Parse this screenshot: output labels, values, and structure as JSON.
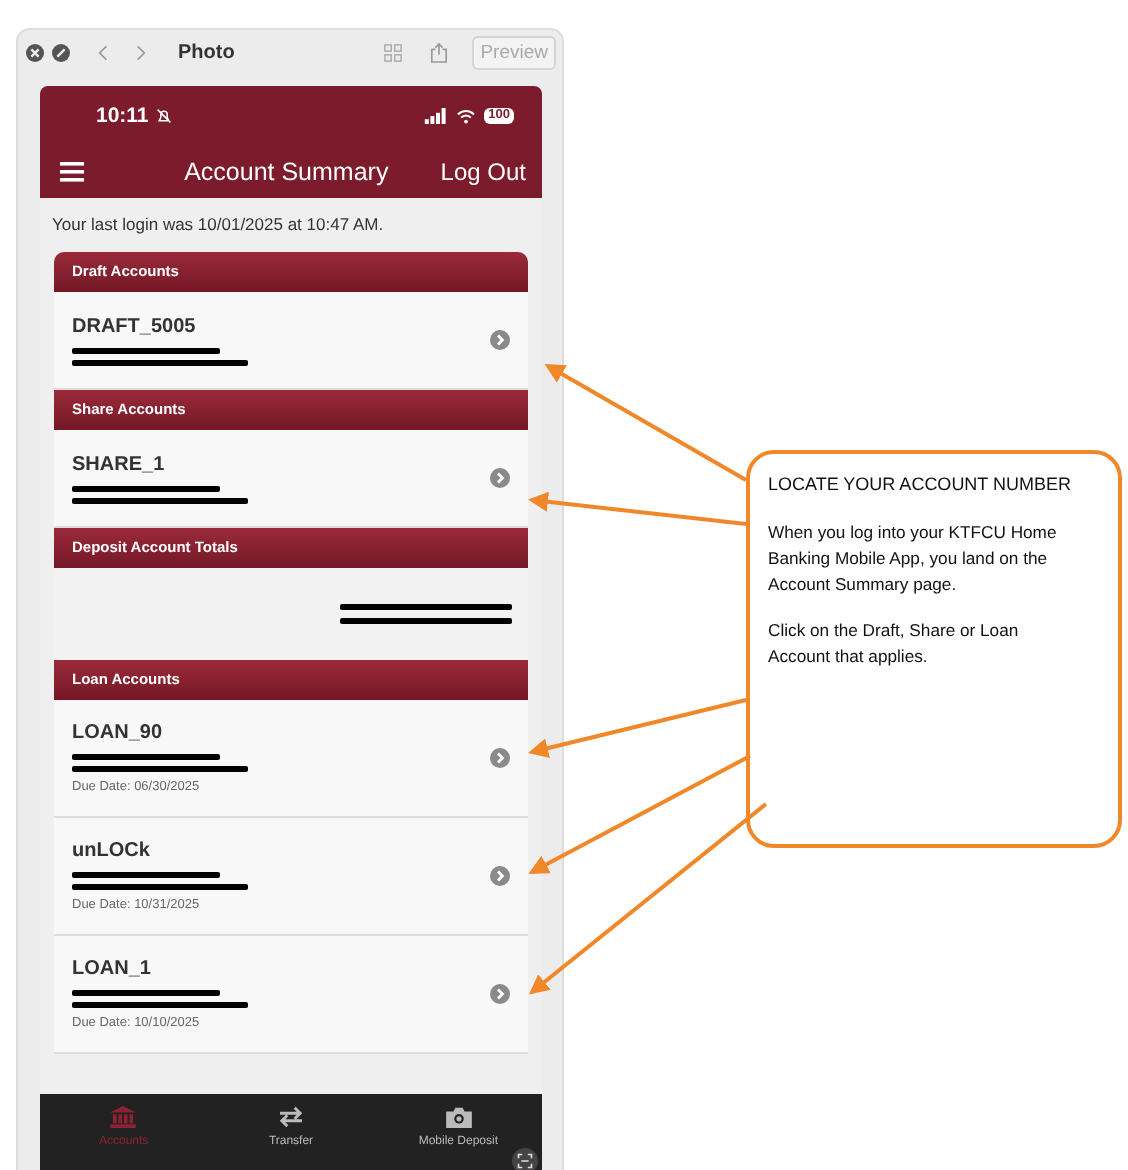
{
  "window": {
    "title": "Photo",
    "preview_button": "Preview"
  },
  "status_bar": {
    "time": "10:11",
    "battery": "100"
  },
  "nav": {
    "title": "Account Summary",
    "action": "Log Out"
  },
  "last_login": "Your last login was 10/01/2025 at 10:47 AM.",
  "sections": [
    {
      "title": "Draft Accounts",
      "kind": "accounts",
      "accounts": [
        {
          "name": "DRAFT_5005"
        }
      ]
    },
    {
      "title": "Share Accounts",
      "kind": "accounts",
      "accounts": [
        {
          "name": "SHARE_1"
        }
      ]
    },
    {
      "title": "Deposit Account Totals",
      "kind": "totals"
    },
    {
      "title": "Loan Accounts",
      "kind": "accounts",
      "accounts": [
        {
          "name": "LOAN_90",
          "due": "Due Date: 06/30/2025"
        },
        {
          "name": "unLOCk",
          "due": "Due Date: 10/31/2025"
        },
        {
          "name": "LOAN_1",
          "due": "Due Date: 10/10/2025"
        }
      ]
    }
  ],
  "tab_bar": [
    {
      "label": "Accounts",
      "kind": "bank",
      "selected": true
    },
    {
      "label": "Transfer",
      "kind": "transfer",
      "selected": false
    },
    {
      "label": "Mobile Deposit",
      "kind": "camera",
      "selected": false
    }
  ],
  "callout": {
    "title": "LOCATE YOUR ACCOUNT NUMBER",
    "paragraphs": [
      "When you log into your KTFCU Home Banking Mobile App, you land on the Account Summary page.",
      "Click on the Draft, Share or Loan Account that applies."
    ]
  }
}
